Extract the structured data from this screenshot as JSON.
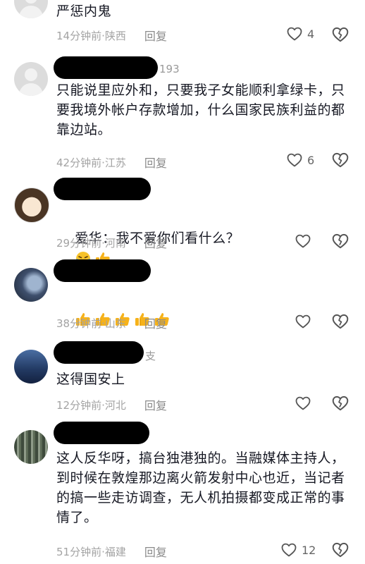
{
  "comments": [
    {
      "text": "严惩内鬼",
      "meta": "14分钟前·陕西",
      "reply": "回复",
      "likes": "4"
    },
    {
      "username_tail": "193",
      "text": "只能说里应外和，只要我子女能顺利拿绿卡，只要我境外帐户存款增加，什么国家民族利益的都靠边站。",
      "meta": "42分钟前·江苏",
      "reply": "回复",
      "likes": "6"
    },
    {
      "text": "爱华：我不爱你们看什么？",
      "emojis": [
        "laughing-crying-emoji",
        "thumbs-up-emoji"
      ],
      "meta": "29分钟前·河南",
      "reply": "回复"
    },
    {
      "emojis": [
        "thumbs-up-emoji",
        "thumbs-up-emoji",
        "thumbs-up-emoji",
        "thumbs-up-emoji",
        "thumbs-up-emoji"
      ],
      "meta": "38分钟前·山东",
      "reply": "回复"
    },
    {
      "username_tail": "支",
      "text": "这得国安上",
      "meta": "12分钟前·河北",
      "reply": "回复"
    },
    {
      "text": "这人反华呀，搞台独港独的。当融媒体主持人，到时候在敦煌那边离火箭发射中心也近，当记者的搞一些走访调查，无人机拍摄都变成正常的事情了。",
      "meta": "51分钟前·福建",
      "reply": "回复",
      "likes": "12"
    }
  ],
  "colors": {
    "text": "#161823",
    "meta": "#a3a3a3",
    "thumb": "#f6b21a"
  }
}
